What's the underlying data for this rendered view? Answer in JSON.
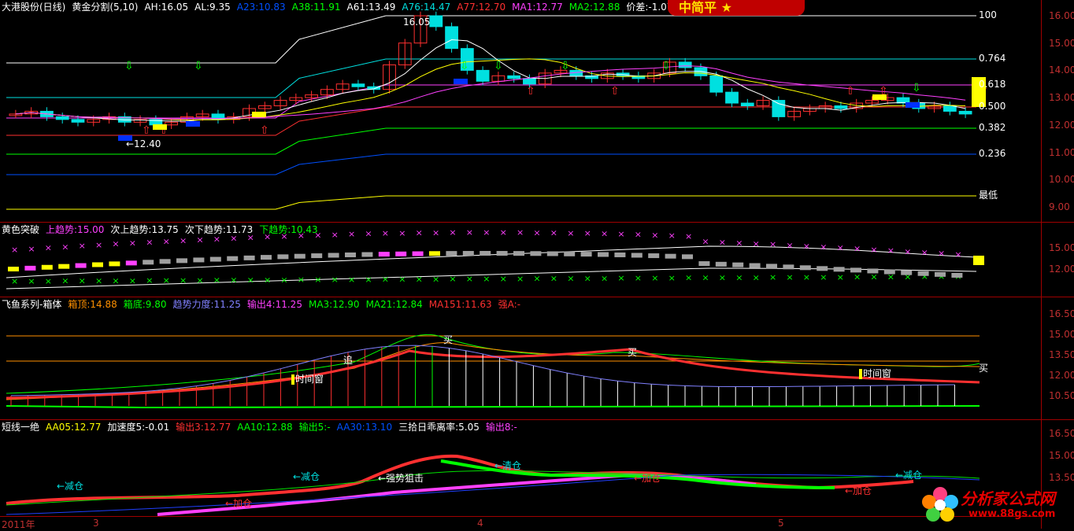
{
  "colors": {
    "up": "#ff3030",
    "down": "#00e0e0",
    "gold": "#ffff00",
    "grid": "#a00000",
    "white": "#ffffff",
    "magenta": "#ff40ff",
    "green": "#00ff00"
  },
  "pane1": {
    "header": [
      {
        "text": "大港股份(日线)",
        "color": "#ffffff"
      },
      {
        "text": "黄金分割(5,10)",
        "color": "#ffffff"
      },
      {
        "text": "AH:16.05",
        "color": "#ffffff"
      },
      {
        "text": "AL:9.35",
        "color": "#ffffff"
      },
      {
        "text": "A23:10.83",
        "color": "#0050ff"
      },
      {
        "text": "A38:11.91",
        "color": "#00ff00"
      },
      {
        "text": "A61:13.49",
        "color": "#ffffff"
      },
      {
        "text": "A76:14.47",
        "color": "#00e0e0"
      },
      {
        "text": "A77:12.70",
        "color": "#ff3030"
      },
      {
        "text": "MA1:12.77",
        "color": "#ff40ff"
      },
      {
        "text": "MA2:12.88",
        "color": "#00ff00"
      },
      {
        "text": "价差:-1.07",
        "color": "#ffffff"
      }
    ],
    "axis": [
      "16.00",
      "15.00",
      "14.00",
      "13.00",
      "12.00",
      "11.00",
      "10.00",
      "9.00"
    ],
    "fib": [
      "100",
      "0.764",
      "0.618",
      "0.500",
      "0.382",
      "0.236",
      "最低"
    ],
    "annotations": {
      "high": "16.05",
      "low": "←12.40"
    },
    "chart_data": {
      "type": "candlestick",
      "ylim": [
        8.6,
        16.4
      ],
      "closes": [
        12.4,
        12.5,
        12.3,
        12.2,
        12.1,
        12.2,
        12.3,
        12.1,
        12.2,
        12.0,
        12.1,
        12.3,
        12.4,
        12.2,
        12.3,
        12.6,
        12.7,
        12.9,
        13.0,
        13.1,
        13.3,
        13.5,
        13.4,
        13.3,
        14.2,
        15.0,
        16.0,
        15.6,
        14.8,
        14.0,
        13.6,
        13.8,
        13.7,
        13.5,
        13.9,
        14.0,
        13.8,
        13.7,
        13.9,
        13.8,
        13.7,
        13.9,
        14.3,
        14.1,
        13.8,
        13.2,
        12.8,
        12.7,
        12.9,
        12.3,
        12.5,
        12.6,
        12.7,
        12.6,
        12.8,
        12.9,
        13.0,
        12.8,
        12.6,
        12.7,
        12.5,
        12.4
      ]
    }
  },
  "pane2": {
    "header": [
      {
        "text": "黄色突破",
        "color": "#ffffff"
      },
      {
        "text": "上趋势:15.00",
        "color": "#ff40ff"
      },
      {
        "text": "次上趋势:13.75",
        "color": "#ffffff"
      },
      {
        "text": "次下趋势:11.73",
        "color": "#ffffff"
      },
      {
        "text": "下趋势:10.43",
        "color": "#00ff00"
      }
    ],
    "axis": [
      "15.00",
      "12.00"
    ]
  },
  "pane3": {
    "header": [
      {
        "text": "飞鱼系列-箱体",
        "color": "#ffffff"
      },
      {
        "text": "箱顶:14.88",
        "color": "#ff9000"
      },
      {
        "text": "箱底:9.80",
        "color": "#00ff00"
      },
      {
        "text": "趋势力度:11.25",
        "color": "#8080ff"
      },
      {
        "text": "输出4:11.25",
        "color": "#ff40ff"
      },
      {
        "text": "MA3:12.90",
        "color": "#00ff00"
      },
      {
        "text": "MA21:12.84",
        "color": "#00ff00"
      },
      {
        "text": "MA151:11.63",
        "color": "#ff3030"
      },
      {
        "text": "强A:-",
        "color": "#ff3030"
      }
    ],
    "axis": [
      "16.50",
      "15.00",
      "13.50",
      "12.00",
      "10.50"
    ],
    "labels": {
      "chase": "追",
      "buy1": "买",
      "buy2": "买",
      "buy3": "买",
      "window1": "时间窗",
      "window2": "时间窗"
    }
  },
  "pane4": {
    "header": [
      {
        "text": "短线一绝",
        "color": "#ffffff"
      },
      {
        "text": "AA05:12.77",
        "color": "#ffff00"
      },
      {
        "text": "加速度5:-0.01",
        "color": "#ffffff"
      },
      {
        "text": "输出3:12.77",
        "color": "#ff3030"
      },
      {
        "text": "AA10:12.88",
        "color": "#00ff00"
      },
      {
        "text": "输出5:-",
        "color": "#00ff00"
      },
      {
        "text": "AA30:13.10",
        "color": "#0050ff"
      },
      {
        "text": "三拾日乖离率:5.05",
        "color": "#ffffff"
      },
      {
        "text": "输出8:-",
        "color": "#ff40ff"
      }
    ],
    "axis": [
      "16.50",
      "15.00",
      "13.50"
    ],
    "labels": {
      "reduce1": "←减仓",
      "add1": "←加仓",
      "reduce2": "←减仓",
      "resist": "←强势狙击",
      "clear": "←清仓",
      "add2": "←加仓",
      "add3": "←加仓",
      "reduce3": "←减仓"
    }
  },
  "dates": {
    "year": "2011年",
    "m3": "3",
    "m4": "4",
    "m5": "5"
  },
  "badge": {
    "text": "中简平"
  },
  "logo": {
    "line1": "分析家公式网",
    "line2": "www.88gs.com"
  }
}
